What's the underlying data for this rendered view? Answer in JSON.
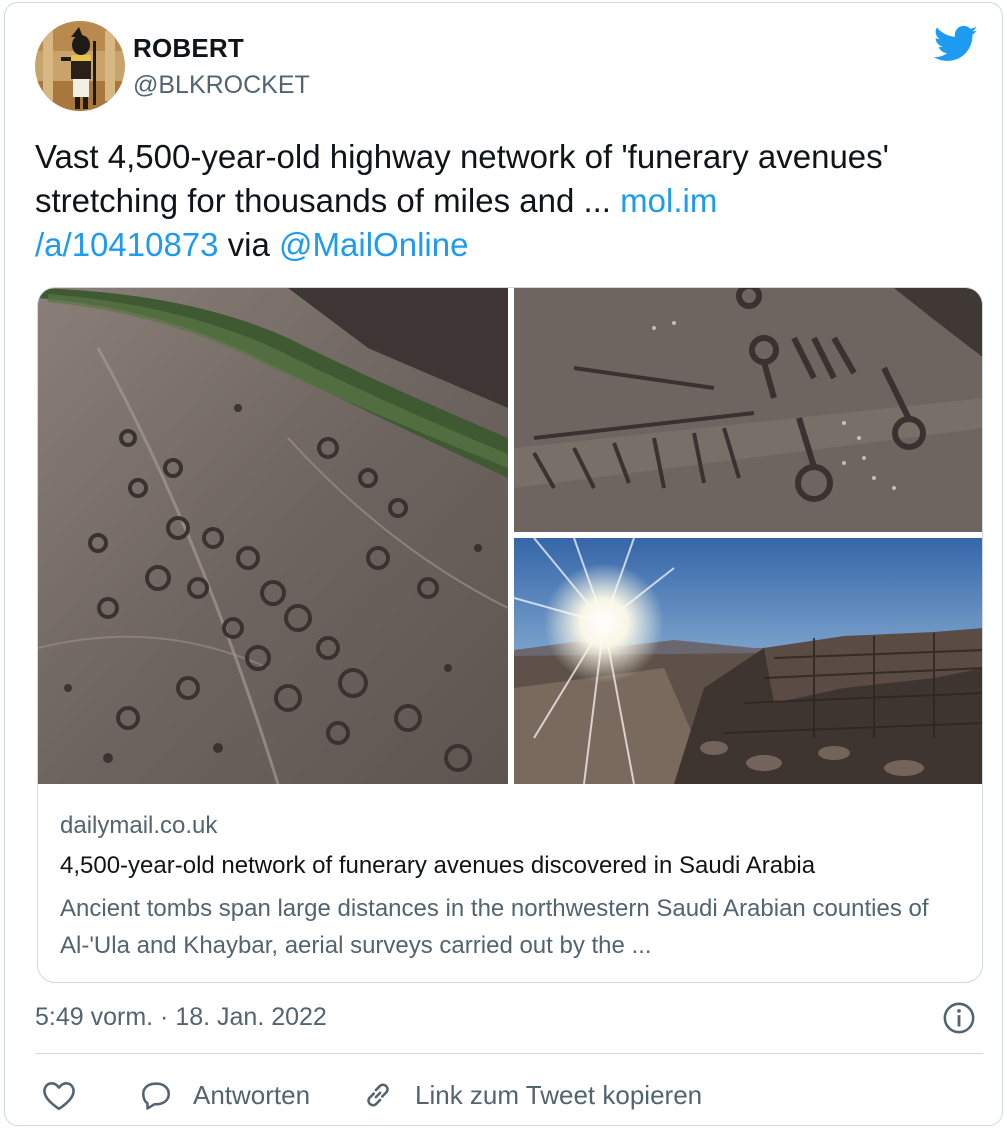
{
  "author": {
    "name": "ROBERT",
    "handle": "@BLKROCKET"
  },
  "icons": {
    "logo": "twitter-bird-icon",
    "info": "info-icon",
    "like": "heart-icon",
    "reply": "speech-bubble-icon",
    "copy_link": "link-chain-icon"
  },
  "tweet": {
    "text_part1": "Vast 4,500-year-old highway network of 'funerary avenues' stretching for thousands of miles and ... ",
    "link_text_line1": "mol.im",
    "link_text_line2": "/a/10410873",
    "via_text": " via ",
    "mention": "@MailOnline"
  },
  "link_card": {
    "domain": "dailymail.co.uk",
    "title": "4,500-year-old network of funerary avenues discovered in Saudi Arabia",
    "description": "Ancient tombs span large distances in the northwestern Saudi Arabian counties of Al-'Ula and Khaybar, aerial surveys carried out by the ..."
  },
  "meta": {
    "timestamp": "5:49 vorm. · 18. Jan. 2022"
  },
  "actions": {
    "reply_label": "Antworten",
    "copy_label": "Link zum Tweet kopieren"
  },
  "colors": {
    "link": "#1d9bf0",
    "secondary_text": "#536471",
    "border": "#cfd9de"
  }
}
